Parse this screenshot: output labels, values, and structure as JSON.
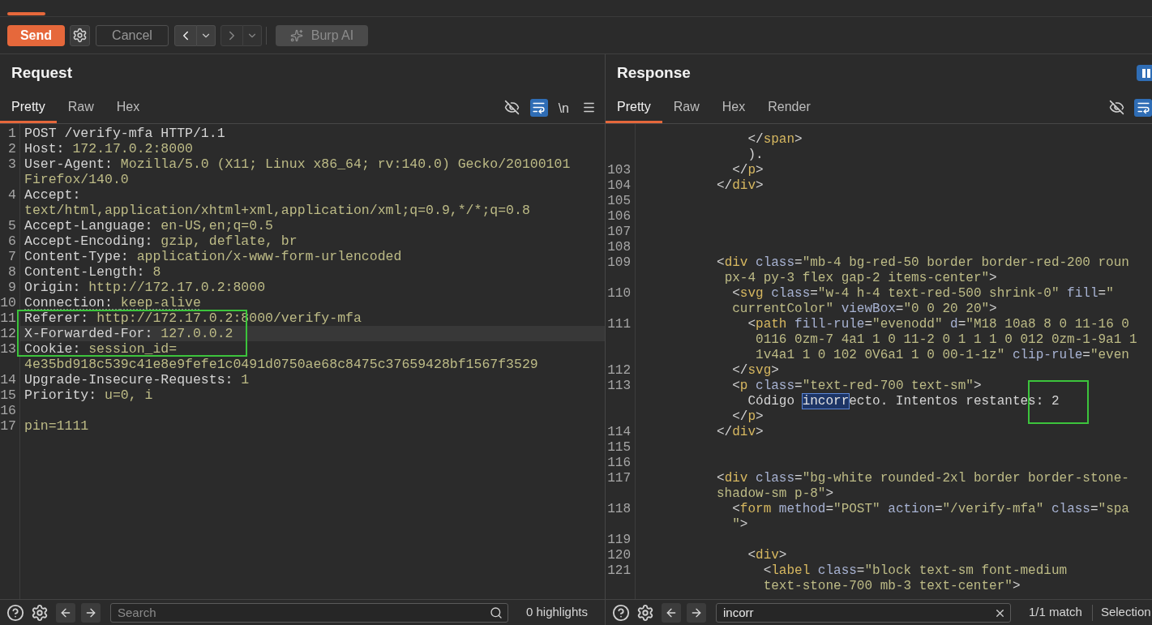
{
  "toolbar": {
    "buttons": [
      {
        "kind": "send",
        "label": "Send",
        "disabled": false
      },
      {
        "kind": "settings",
        "disabled": false
      },
      {
        "kind": "cancel",
        "label": "Cancel",
        "disabled": true
      },
      {
        "kind": "back",
        "disabled": false
      },
      {
        "kind": "forward",
        "disabled": true
      },
      {
        "kind": "ai",
        "label": "Burp AI",
        "disabled": true
      }
    ]
  },
  "request": {
    "title": "Request",
    "tabs": [
      {
        "label": "Pretty",
        "selected": true
      },
      {
        "label": "Raw",
        "selected": false
      },
      {
        "label": "Hex",
        "selected": false
      }
    ],
    "tools": [
      {
        "kind": "hide",
        "on": false
      },
      {
        "kind": "wrap",
        "on": true
      },
      {
        "kind": "newlines",
        "label": "\\n",
        "on": false
      },
      {
        "kind": "menu",
        "on": false
      }
    ],
    "lines": [
      {
        "kind": "plain",
        "number": "1",
        "tokens": [
          {
            "kind": "plain",
            "text": "POST /verify-mfa HTTP/1.1"
          }
        ]
      },
      {
        "kind": "plain",
        "number": "2",
        "tokens": [
          {
            "kind": "plain",
            "text": "Host: "
          },
          {
            "kind": "value",
            "text": "172.17.0.2:8000"
          }
        ]
      },
      {
        "kind": "plain",
        "number": "3",
        "tokens": [
          {
            "kind": "plain",
            "text": "User-Agent: "
          },
          {
            "kind": "value",
            "text": "Mozilla/5.0 (X11; Linux x86_64; rv:140.0) Gecko/20100101"
          }
        ]
      },
      {
        "kind": "plain",
        "tokens": [
          {
            "kind": "value",
            "text": "Firefox/140.0"
          }
        ]
      },
      {
        "kind": "plain",
        "number": "4",
        "tokens": [
          {
            "kind": "plain",
            "text": "Accept:"
          }
        ]
      },
      {
        "kind": "plain",
        "tokens": [
          {
            "kind": "value",
            "text": "text/html,application/xhtml+xml,application/xml;q=0.9,*/*;q=0.8"
          }
        ]
      },
      {
        "kind": "plain",
        "number": "5",
        "tokens": [
          {
            "kind": "plain",
            "text": "Accept-Language: "
          },
          {
            "kind": "value",
            "text": "en-US,en;q=0.5"
          }
        ]
      },
      {
        "kind": "plain",
        "number": "6",
        "tokens": [
          {
            "kind": "plain",
            "text": "Accept-Encoding: "
          },
          {
            "kind": "value",
            "text": "gzip, deflate, br"
          }
        ]
      },
      {
        "kind": "plain",
        "number": "7",
        "tokens": [
          {
            "kind": "plain",
            "text": "Content-Type: "
          },
          {
            "kind": "value",
            "text": "application/x-www-form-urlencoded"
          }
        ]
      },
      {
        "kind": "plain",
        "number": "8",
        "tokens": [
          {
            "kind": "plain",
            "text": "Content-Length: "
          },
          {
            "kind": "value",
            "text": "8"
          }
        ]
      },
      {
        "kind": "plain",
        "number": "9",
        "tokens": [
          {
            "kind": "plain",
            "text": "Origin: "
          },
          {
            "kind": "value",
            "text": "http://172.17.0.2:8000"
          }
        ]
      },
      {
        "kind": "underlined",
        "number": "10",
        "tokens": [
          {
            "kind": "plain",
            "text": "Connection: "
          },
          {
            "kind": "value",
            "text": "keep-alive"
          }
        ]
      },
      {
        "kind": "frame",
        "lines": [
          {
            "kind": "plain",
            "number": "11",
            "tokens": [
              {
                "kind": "plain",
                "text": "Referer: "
              },
              {
                "kind": "value",
                "text": "http://172.17.0.2:8000/verify-mfa"
              }
            ]
          },
          {
            "kind": "current",
            "number": "12",
            "tokens": [
              {
                "kind": "plain",
                "text": "X-Forwarded-For: "
              },
              {
                "kind": "value",
                "text": "127.0.0.2"
              }
            ]
          },
          {
            "kind": "plain",
            "number": "13",
            "tokens": [
              {
                "kind": "plain",
                "text": "Cookie: "
              },
              {
                "kind": "value",
                "text": "session_id="
              }
            ]
          }
        ]
      },
      {
        "kind": "plain",
        "tokens": [
          {
            "kind": "value",
            "text": "4e35bd918c539c41e8e9fefe1c0491d0750ae68c8475c37659428bf1567f3529"
          }
        ]
      },
      {
        "kind": "plain",
        "number": "14",
        "tokens": [
          {
            "kind": "plain",
            "text": "Upgrade-Insecure-Requests: "
          },
          {
            "kind": "value",
            "text": "1"
          }
        ]
      },
      {
        "kind": "plain",
        "number": "15",
        "tokens": [
          {
            "kind": "plain",
            "text": "Priority: "
          },
          {
            "kind": "value",
            "text": "u=0, i"
          }
        ]
      },
      {
        "kind": "plain",
        "number": "16"
      },
      {
        "kind": "plain",
        "number": "17",
        "tokens": [
          {
            "kind": "value",
            "text": "pin=1111"
          }
        ]
      }
    ],
    "footer": {
      "search": {
        "placeholder": "Search"
      },
      "status": "0 highlights"
    }
  },
  "response": {
    "title": "Response",
    "header_actions": [
      {
        "kind": "layout",
        "on": true
      }
    ],
    "tabs": [
      {
        "label": "Pretty",
        "selected": true
      },
      {
        "label": "Raw",
        "selected": false
      },
      {
        "label": "Hex",
        "selected": false
      },
      {
        "label": "Render",
        "selected": false
      }
    ],
    "tools": [
      {
        "kind": "hide",
        "on": false
      },
      {
        "kind": "wrap",
        "on": true
      }
    ],
    "lines": [
      {
        "tokens": [
          {
            "kind": "punct",
            "text": "              </"
          },
          {
            "kind": "tag",
            "text": "span"
          },
          {
            "kind": "punct",
            "text": ">"
          }
        ]
      },
      {
        "tokens": [
          {
            "kind": "text",
            "text": "              )."
          }
        ]
      },
      {
        "number": "103",
        "tokens": [
          {
            "kind": "punct",
            "text": "            </"
          },
          {
            "kind": "tag",
            "text": "p"
          },
          {
            "kind": "punct",
            "text": ">"
          }
        ]
      },
      {
        "number": "104",
        "tokens": [
          {
            "kind": "punct",
            "text": "          </"
          },
          {
            "kind": "tag",
            "text": "div"
          },
          {
            "kind": "punct",
            "text": ">"
          }
        ]
      },
      {
        "number": "105"
      },
      {
        "number": "106"
      },
      {
        "number": "107"
      },
      {
        "number": "108"
      },
      {
        "number": "109",
        "tokens": [
          {
            "kind": "punct",
            "text": "          <"
          },
          {
            "kind": "tag",
            "text": "div"
          },
          {
            "kind": "attr",
            "text": " class"
          },
          {
            "kind": "punct",
            "text": "="
          },
          {
            "kind": "value",
            "text": "\"mb-4 bg-red-50 border border-red-200 roun"
          }
        ]
      },
      {
        "tokens": [
          {
            "kind": "value",
            "text": "           px-4 py-3 flex gap-2 items-center\""
          },
          {
            "kind": "punct",
            "text": ">"
          }
        ]
      },
      {
        "number": "110",
        "tokens": [
          {
            "kind": "punct",
            "text": "            <"
          },
          {
            "kind": "tag",
            "text": "svg"
          },
          {
            "kind": "attr",
            "text": " class"
          },
          {
            "kind": "punct",
            "text": "="
          },
          {
            "kind": "value",
            "text": "\"w-4 h-4 text-red-500 shrink-0\""
          },
          {
            "kind": "attr",
            "text": " fill"
          },
          {
            "kind": "punct",
            "text": "="
          },
          {
            "kind": "value",
            "text": "\""
          }
        ]
      },
      {
        "tokens": [
          {
            "kind": "value",
            "text": "            currentColor\""
          },
          {
            "kind": "attr",
            "text": " viewBox"
          },
          {
            "kind": "punct",
            "text": "="
          },
          {
            "kind": "value",
            "text": "\"0 0 20 20\""
          },
          {
            "kind": "punct",
            "text": ">"
          }
        ]
      },
      {
        "number": "111",
        "tokens": [
          {
            "kind": "punct",
            "text": "              <"
          },
          {
            "kind": "tag",
            "text": "path"
          },
          {
            "kind": "attr",
            "text": " fill-rule"
          },
          {
            "kind": "punct",
            "text": "="
          },
          {
            "kind": "value",
            "text": "\"evenodd\""
          },
          {
            "kind": "attr",
            "text": " d"
          },
          {
            "kind": "punct",
            "text": "="
          },
          {
            "kind": "value",
            "text": "\"M18 10a8 8 0 11-16 0"
          }
        ]
      },
      {
        "tokens": [
          {
            "kind": "value",
            "text": "               0116 0zm-7 4a1 1 0 11-2 0 1 1 1 0 012 0zm-1-9a1 1"
          }
        ]
      },
      {
        "tokens": [
          {
            "kind": "value",
            "text": "               1v4a1 1 0 102 0V6a1 1 0 00-1-1z\""
          },
          {
            "kind": "attr",
            "text": " clip-rule"
          },
          {
            "kind": "punct",
            "text": "="
          },
          {
            "kind": "value",
            "text": "\"even"
          }
        ]
      },
      {
        "number": "112",
        "tokens": [
          {
            "kind": "punct",
            "text": "            </"
          },
          {
            "kind": "tag",
            "text": "svg"
          },
          {
            "kind": "punct",
            "text": ">"
          }
        ]
      },
      {
        "number": "113",
        "tokens": [
          {
            "kind": "punct",
            "text": "            <"
          },
          {
            "kind": "tag",
            "text": "p"
          },
          {
            "kind": "attr",
            "text": " class"
          },
          {
            "kind": "punct",
            "text": "="
          },
          {
            "kind": "value",
            "text": "\"text-red-700 text-sm\""
          },
          {
            "kind": "punct",
            "text": ">"
          }
        ]
      },
      {
        "tokens": [
          {
            "kind": "text",
            "text": "              Código "
          },
          {
            "kind": "match",
            "text": "incorr"
          },
          {
            "kind": "text",
            "text": "ecto. Intentos restante"
          },
          {
            "kind": "framed",
            "text": "s: 2"
          }
        ]
      },
      {
        "tokens": [
          {
            "kind": "punct",
            "text": "            </"
          },
          {
            "kind": "tag",
            "text": "p"
          },
          {
            "kind": "punct",
            "text": ">"
          }
        ]
      },
      {
        "number": "114",
        "tokens": [
          {
            "kind": "punct",
            "text": "          </"
          },
          {
            "kind": "tag",
            "text": "div"
          },
          {
            "kind": "punct",
            "text": ">"
          }
        ]
      },
      {
        "number": "115"
      },
      {
        "number": "116"
      },
      {
        "number": "117",
        "tokens": [
          {
            "kind": "punct",
            "text": "          <"
          },
          {
            "kind": "tag",
            "text": "div"
          },
          {
            "kind": "attr",
            "text": " class"
          },
          {
            "kind": "punct",
            "text": "="
          },
          {
            "kind": "value",
            "text": "\"bg-white rounded-2xl border border-stone-"
          }
        ]
      },
      {
        "tokens": [
          {
            "kind": "value",
            "text": "          shadow-sm p-8\""
          },
          {
            "kind": "punct",
            "text": ">"
          }
        ]
      },
      {
        "number": "118",
        "tokens": [
          {
            "kind": "punct",
            "text": "            <"
          },
          {
            "kind": "tag",
            "text": "form"
          },
          {
            "kind": "attr",
            "text": " method"
          },
          {
            "kind": "punct",
            "text": "="
          },
          {
            "kind": "value",
            "text": "\"POST\""
          },
          {
            "kind": "attr",
            "text": " action"
          },
          {
            "kind": "punct",
            "text": "="
          },
          {
            "kind": "value",
            "text": "\"/verify-mfa\""
          },
          {
            "kind": "attr",
            "text": " class"
          },
          {
            "kind": "punct",
            "text": "="
          },
          {
            "kind": "value",
            "text": "\"spa"
          }
        ]
      },
      {
        "tokens": [
          {
            "kind": "value",
            "text": "            \""
          },
          {
            "kind": "punct",
            "text": ">"
          }
        ]
      },
      {
        "number": "119"
      },
      {
        "number": "120",
        "tokens": [
          {
            "kind": "punct",
            "text": "              <"
          },
          {
            "kind": "tag",
            "text": "div"
          },
          {
            "kind": "punct",
            "text": ">"
          }
        ]
      },
      {
        "number": "121",
        "tokens": [
          {
            "kind": "punct",
            "text": "                <"
          },
          {
            "kind": "tag",
            "text": "label"
          },
          {
            "kind": "attr",
            "text": " class"
          },
          {
            "kind": "punct",
            "text": "="
          },
          {
            "kind": "value",
            "text": "\"block text-sm font-medium"
          }
        ]
      },
      {
        "tokens": [
          {
            "kind": "value",
            "text": "                text-stone-700 mb-3 text-center\""
          },
          {
            "kind": "punct",
            "text": ">"
          }
        ]
      }
    ],
    "footer": {
      "search": {
        "value": "incorr"
      },
      "status": "1/1 match",
      "mode": "Selection"
    }
  }
}
